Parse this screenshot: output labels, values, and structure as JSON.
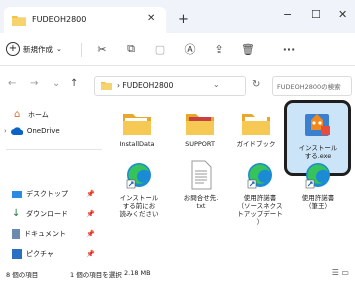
{
  "tab": {
    "title": "FUDEOH2800"
  },
  "window_buttons": [
    "−",
    "☐",
    "✕"
  ],
  "command_bar": {
    "new_label": "新規作成"
  },
  "address": {
    "path": "FUDEOH2800",
    "search_placeholder": "FUDEOH2800の検索"
  },
  "sidebar": {
    "items": [
      {
        "label": "ホーム"
      },
      {
        "label": "OneDrive"
      },
      {
        "label": "デスクトップ"
      },
      {
        "label": "ダウンロード"
      },
      {
        "label": "ドキュメント"
      },
      {
        "label": "ピクチャ"
      }
    ]
  },
  "files": [
    {
      "label": "InstallData",
      "type": "folder"
    },
    {
      "label": "SUPPORT",
      "type": "folder"
    },
    {
      "label": "ガイドブック",
      "type": "folder"
    },
    {
      "label": "インストール\nする.exe",
      "type": "exe"
    },
    {
      "label": "インストール\nする前にお\n読みください",
      "type": "edge-shortcut"
    },
    {
      "label": "お問合せ先.\ntxt",
      "type": "txt"
    },
    {
      "label": "使用許諾書\n（ソースネクス\nトアップデート\n）",
      "type": "edge-shortcut"
    },
    {
      "label": "使用許諾書\n（筆王）",
      "type": "edge-shortcut"
    }
  ],
  "status": {
    "count": "8 個の項目",
    "selected": "1 個の項目を選択",
    "size": "2.18 MB"
  },
  "colors": {
    "folder": "#f3c24b",
    "selection": "#cce4f7",
    "accent": "#0067c0"
  }
}
